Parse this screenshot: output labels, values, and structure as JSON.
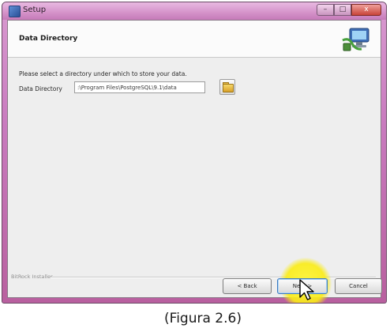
{
  "window": {
    "title": "Setup",
    "icon": "setup-app-icon",
    "buttons": {
      "minimize": "–",
      "maximize": "□",
      "close": "x"
    }
  },
  "header": {
    "title": "Data Directory",
    "graphic": "computer-network-icon"
  },
  "body": {
    "instruction": "Please select a directory under which to store your data.",
    "directory_label": "Data Directory",
    "directory_value": ":\\Program Files\\PostgreSQL\\9.1\\data",
    "browse_icon": "folder-icon"
  },
  "footer": {
    "installer_label": "BitRock Installer",
    "back_label": "< Back",
    "next_label": "Next >",
    "cancel_label": "Cancel"
  },
  "caption": "(Figura 2.6)",
  "colors": {
    "window_frame": "#c97bbf",
    "highlight": "#faec14"
  }
}
